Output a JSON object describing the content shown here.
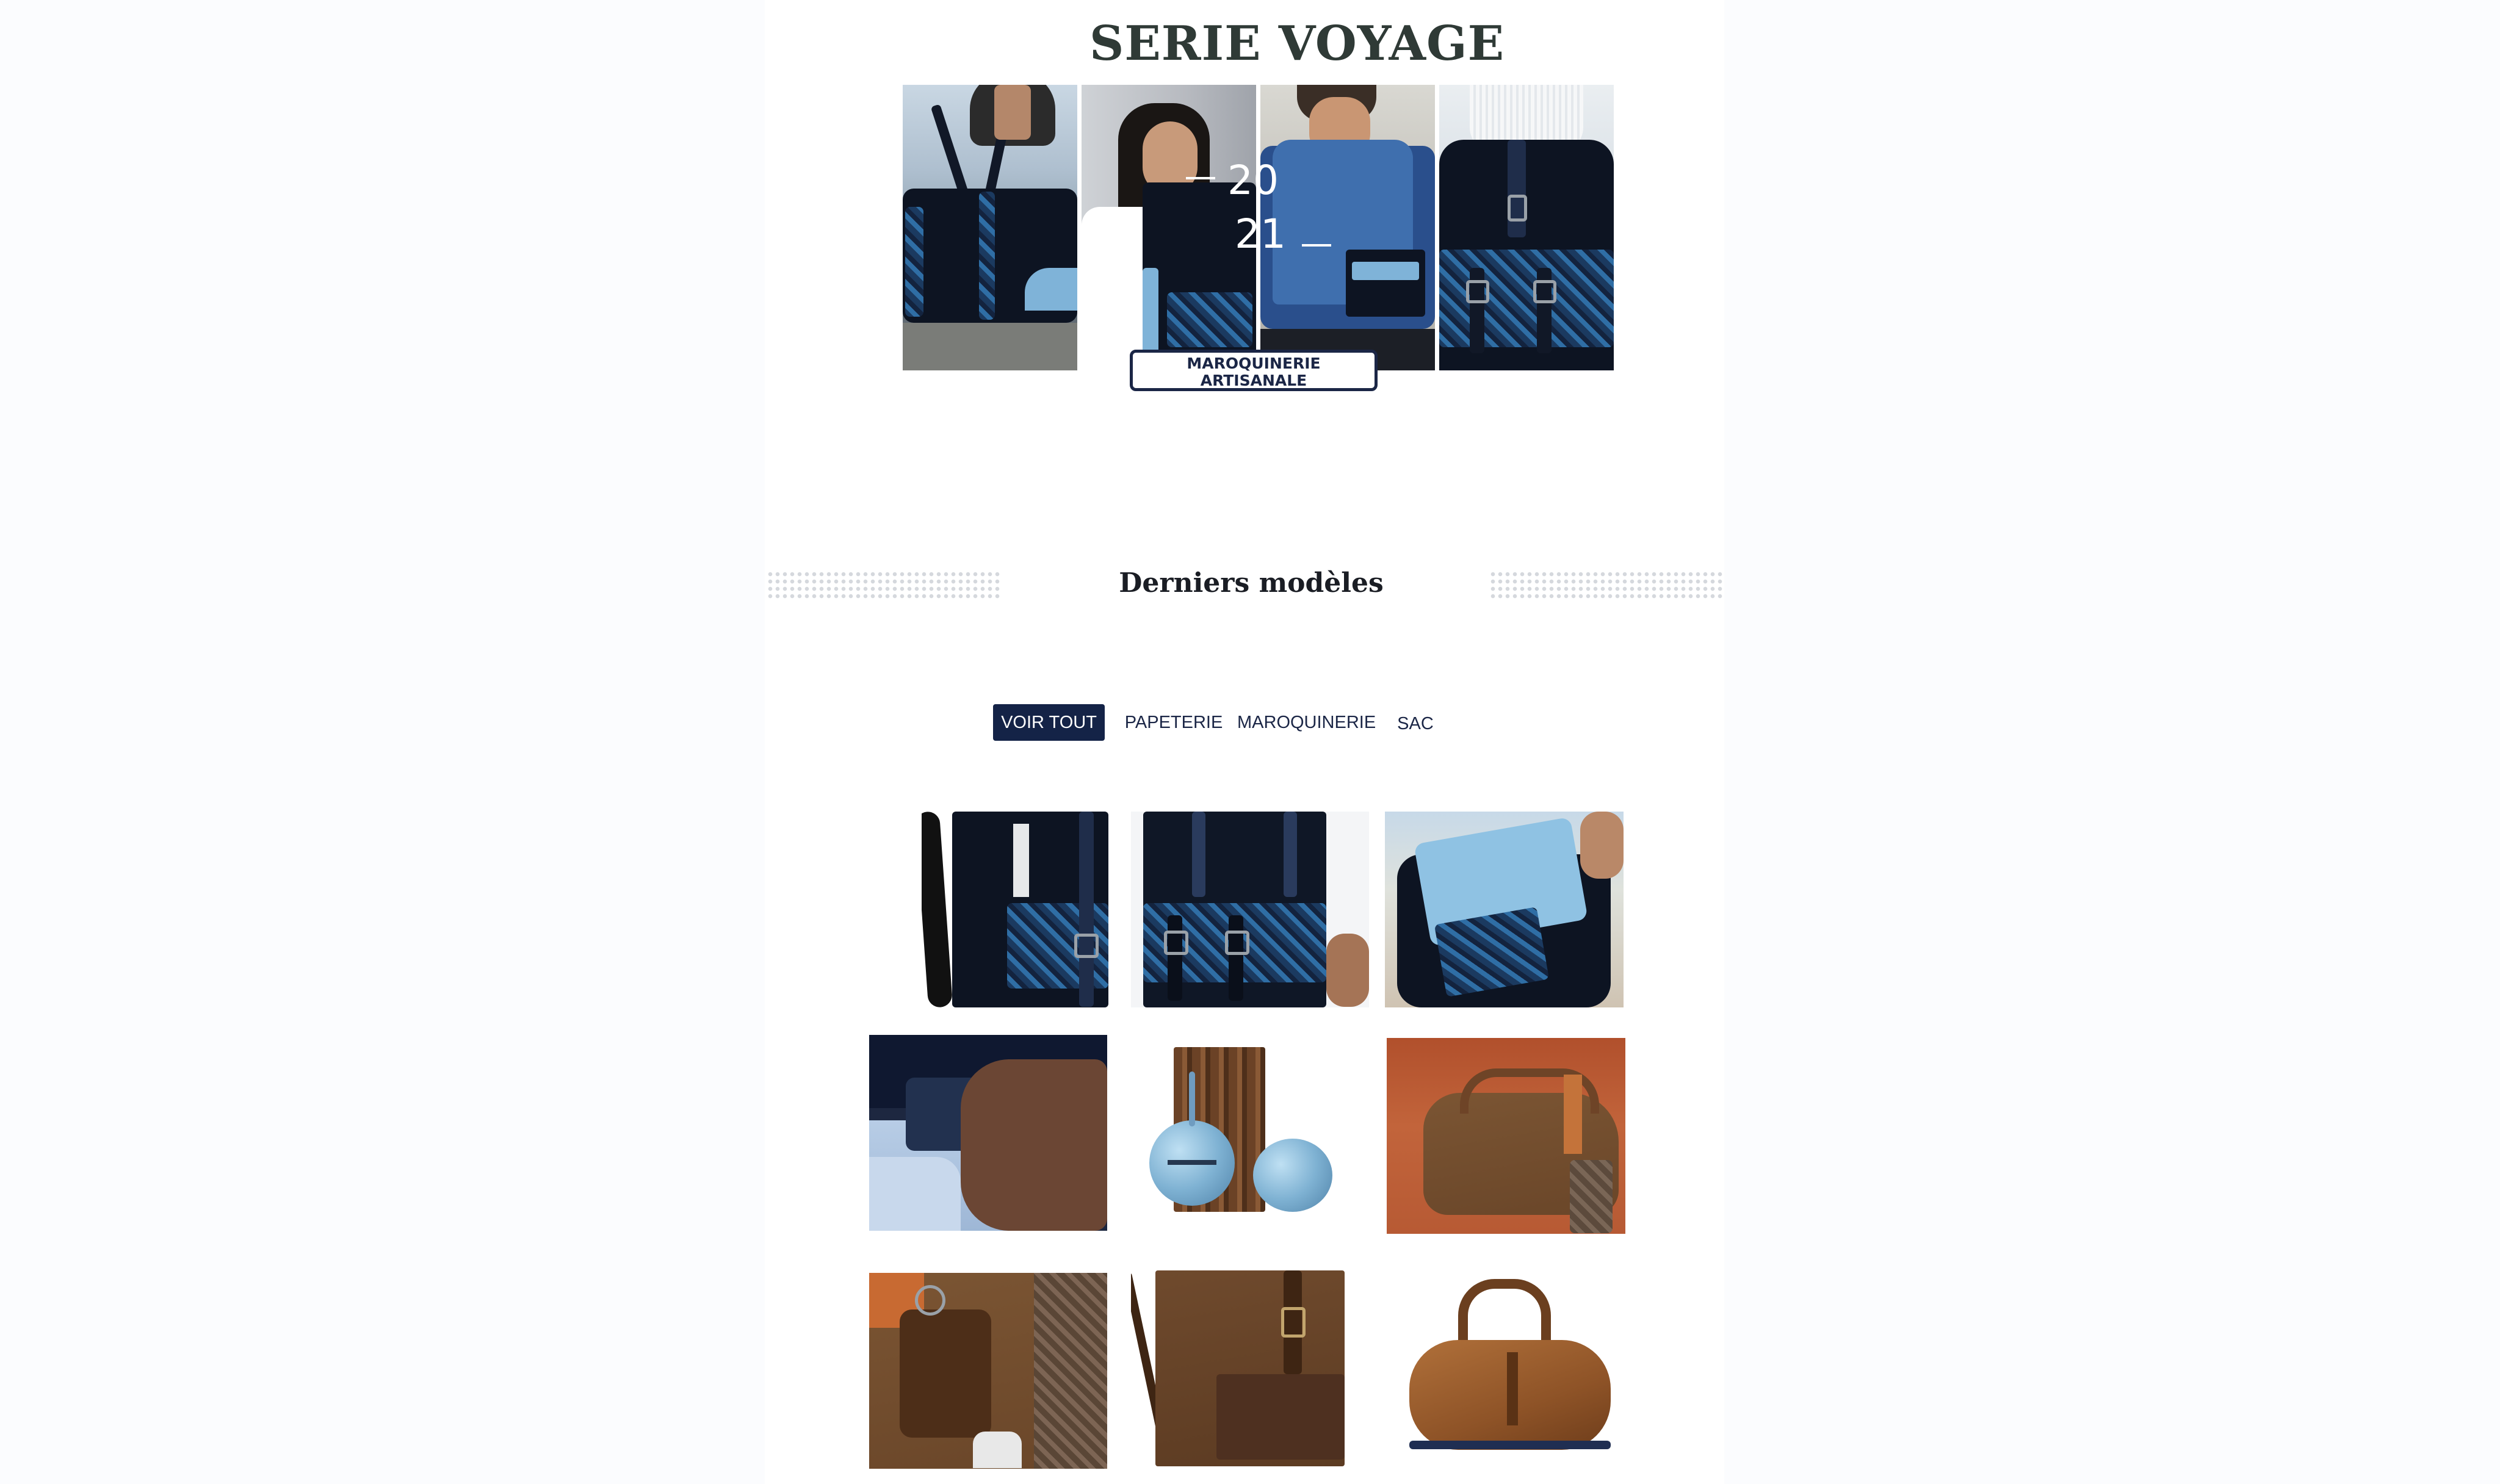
{
  "hero": {
    "title": "SERIE VOYAGE",
    "year_top": "20",
    "year_bottom": "21",
    "badge_line1": "MAROQUINERIE",
    "badge_line2": "ARTISANALE"
  },
  "section": {
    "title": "Derniers modèles"
  },
  "filters": [
    {
      "label": "VOIR TOUT",
      "active": true
    },
    {
      "label": "PAPETERIE",
      "active": false
    },
    {
      "label": "MAROQUINERIE",
      "active": false
    },
    {
      "label": "SAC",
      "active": false
    }
  ],
  "colors": {
    "accent": "#142347",
    "title": "#2f3a36",
    "background": "#fbfcfe"
  }
}
